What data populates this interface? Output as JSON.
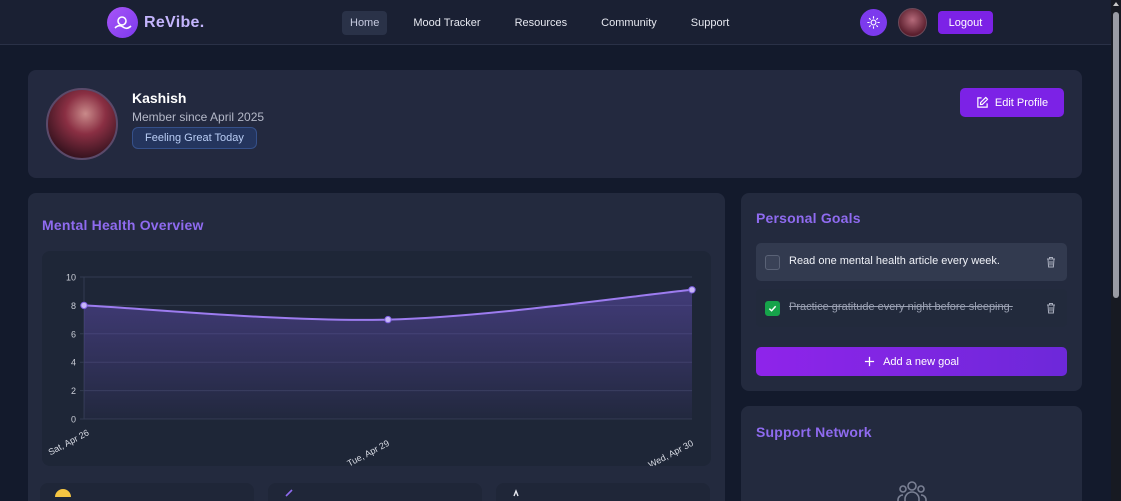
{
  "nav": {
    "brand": "ReVibe.",
    "links": [
      {
        "label": "Home",
        "active": true
      },
      {
        "label": "Mood Tracker",
        "active": false
      },
      {
        "label": "Resources",
        "active": false
      },
      {
        "label": "Community",
        "active": false
      },
      {
        "label": "Support",
        "active": false
      }
    ],
    "logout_label": "Logout",
    "theme_icon": "sun-icon"
  },
  "profile": {
    "name": "Kashish",
    "member_since": "Member since April 2025",
    "mood_badge": "Feeling Great Today",
    "edit_label": "Edit Profile"
  },
  "overview": {
    "title": "Mental Health Overview"
  },
  "chart_data": {
    "type": "line",
    "categories": [
      "Sat, Apr 26",
      "Tue, Apr 29",
      "Wed, Apr 30"
    ],
    "series": [
      {
        "values": [
          8,
          7,
          9.1
        ]
      }
    ],
    "yticks": [
      0,
      2,
      4,
      6,
      8,
      10
    ],
    "ylim": [
      0,
      10
    ],
    "title": "",
    "xlabel": "",
    "ylabel": "",
    "grid": true,
    "colors": {
      "line": "#9d7cf0",
      "area": "#6d55c9"
    }
  },
  "goals": {
    "title": "Personal Goals",
    "items": [
      {
        "text": "Read one mental health article every week.",
        "done": false
      },
      {
        "text": "Practice gratitude every night before sleeping.",
        "done": true
      }
    ],
    "add_label": "Add a new goal"
  },
  "support": {
    "title": "Support Network",
    "icon": "users-icon"
  },
  "colors": {
    "accent": "#7c22e6",
    "title": "#8f6bf0",
    "bg": "#131a2c",
    "card": "#232a3e",
    "success": "#16a34a"
  }
}
